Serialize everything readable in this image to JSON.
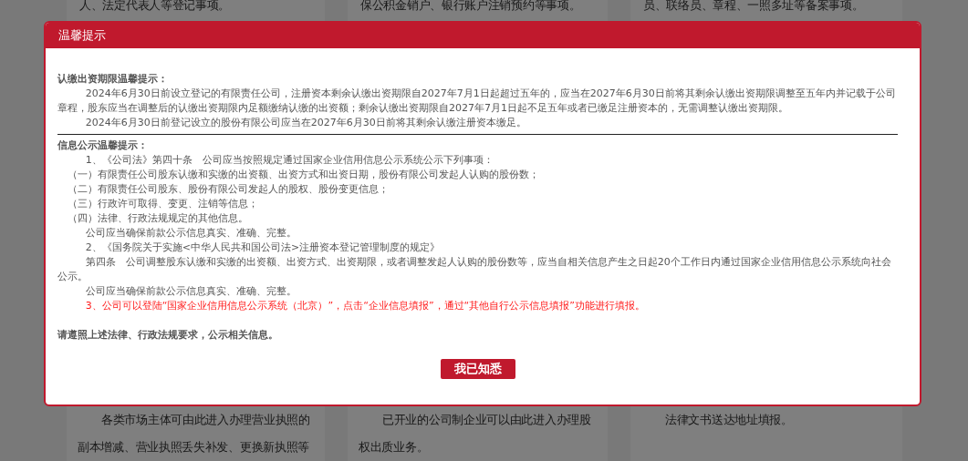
{
  "background": {
    "columns": [
      {
        "top": "人、法定代表人等登记事项。",
        "bottom": "各类市场主体可由此进入办理营业执照的副本增减、营业执照丢失补发、更换新执照等"
      },
      {
        "top": "保公积金销户、银行账户注销预约等事项。",
        "bottom": "已开业的公司制企业可以由此进入办理股权出质业务。"
      },
      {
        "top": "员、联络员、章程、一照多址等备案事项。",
        "bottom": "法律文书送达地址填报。"
      }
    ]
  },
  "dialog": {
    "title": "温馨提示",
    "sections": [
      {
        "heading": "认缴出资期限温馨提示：",
        "divider": true,
        "paragraphs": [
          {
            "kind": "para",
            "text": "2024年6月30日前设立登记的有限责任公司，注册资本剩余认缴出资期限自2027年7月1日起超过五年的，应当在2027年6月30日前将其剩余认缴出资期限调整至五年内并记载于公司章程，股东应当在调整后的认缴出资期限内足额缴纳认缴的出资额；剩余认缴出资期限自2027年7月1日起不足五年或者已缴足注册资本的，无需调整认缴出资期限。"
          },
          {
            "kind": "para",
            "text": "2024年6月30日前登记设立的股份有限公司应当在2027年6月30日前将其剩余认缴注册资本缴足。"
          }
        ]
      },
      {
        "heading": "信息公示温馨提示：",
        "divider": false,
        "paragraphs": [
          {
            "kind": "para",
            "text": "1、《公司法》第四十条　公司应当按照规定通过国家企业信用信息公示系统公示下列事项："
          },
          {
            "kind": "item",
            "text": "（一）有限责任公司股东认缴和实缴的出资额、出资方式和出资日期，股份有限公司发起人认购的股份数；"
          },
          {
            "kind": "item",
            "text": "（二）有限责任公司股东、股份有限公司发起人的股权、股份变更信息；"
          },
          {
            "kind": "item",
            "text": "（三）行政许可取得、变更、注销等信息；"
          },
          {
            "kind": "item",
            "text": "（四）法律、行政法规规定的其他信息。"
          },
          {
            "kind": "para",
            "text": "公司应当确保前款公示信息真实、准确、完整。"
          },
          {
            "kind": "para",
            "text": "2、《国务院关于实施<中华人民共和国公司法>注册资本登记管理制度的规定》"
          },
          {
            "kind": "para",
            "text": "第四条　公司调整股东认缴和实缴的出资额、出资方式、出资期限，或者调整发起人认购的股份数等，应当自相关信息产生之日起20个工作日内通过国家企业信用信息公示系统向社会公示。"
          },
          {
            "kind": "para",
            "text": "公司应当确保前款公示信息真实、准确、完整。"
          },
          {
            "kind": "alert",
            "text": "3、公司可以登陆“国家企业信用信息公示系统（北京）”，点击“企业信息填报”，通过“其他自行公示信息填报”功能进行填报。"
          }
        ]
      }
    ],
    "closing": "请遵照上述法律、行政法规要求，公示相关信息。",
    "button": "我已知悉"
  }
}
